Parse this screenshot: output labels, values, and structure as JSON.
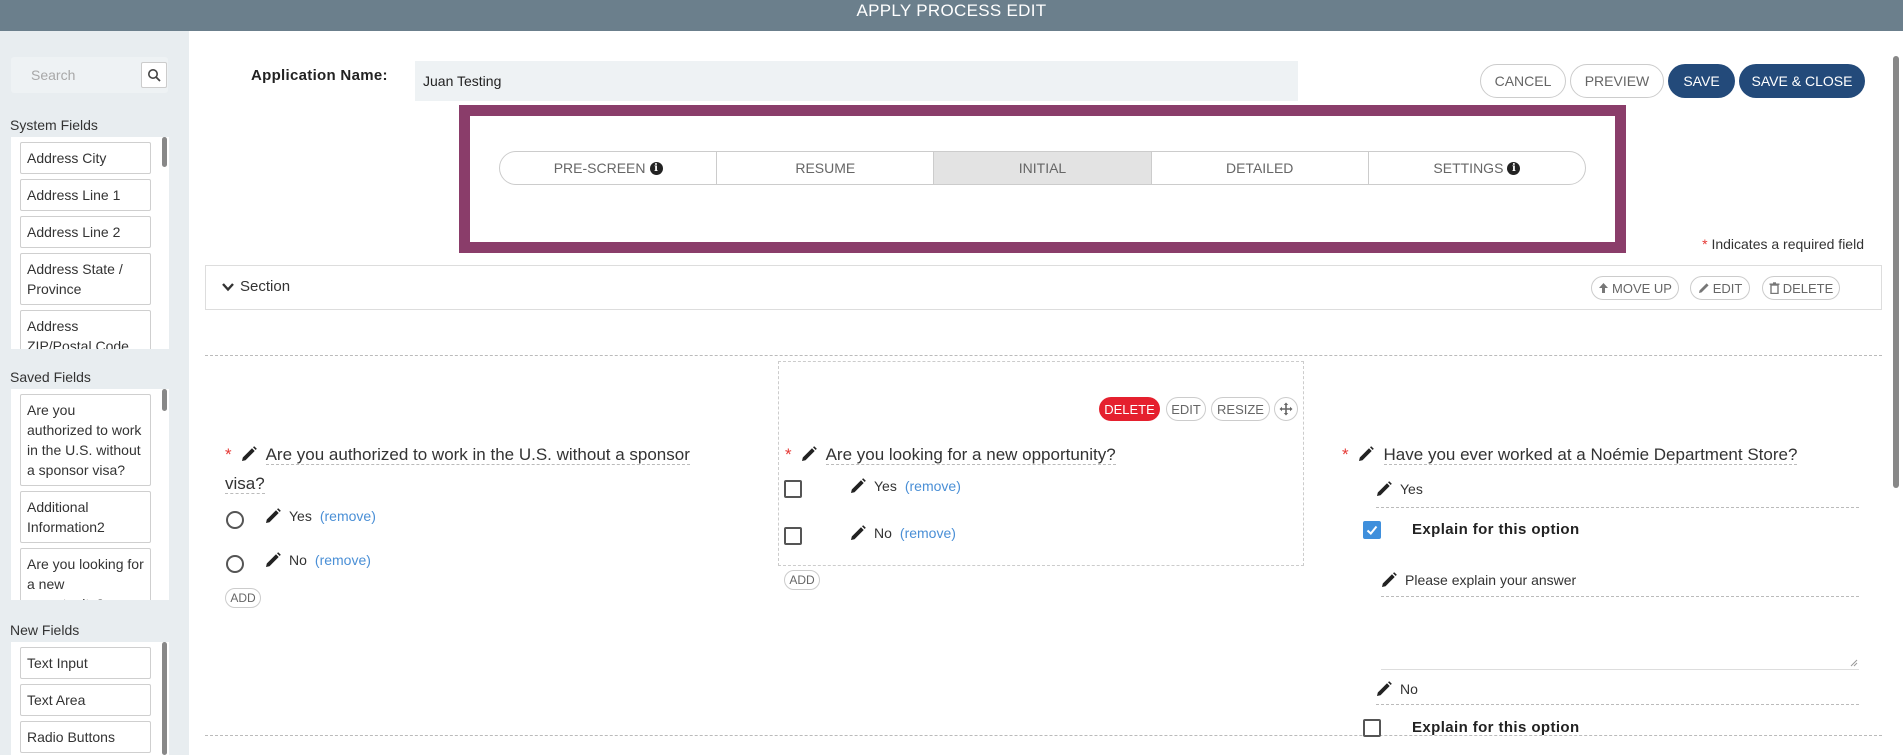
{
  "header": {
    "title": "APPLY PROCESS EDIT"
  },
  "sidebar": {
    "search_placeholder": "Search",
    "system_fields": {
      "heading": "System Fields",
      "items": [
        "Address City",
        "Address Line 1",
        "Address Line 2",
        "Address State / Province",
        "Address ZIP/Postal Code"
      ]
    },
    "saved_fields": {
      "heading": "Saved Fields",
      "items": [
        "Are you authorized to work in the U.S. without a sponsor visa?",
        "Additional Information2",
        "Are you looking for a new opportunity?"
      ]
    },
    "new_fields": {
      "heading": "New Fields",
      "items": [
        "Text Input",
        "Text Area",
        "Radio Buttons"
      ]
    }
  },
  "form": {
    "app_name_label": "Application Name:",
    "app_name_value": "Juan Testing",
    "buttons": {
      "cancel": "CANCEL",
      "preview": "PREVIEW",
      "save": "SAVE",
      "save_close": "SAVE & CLOSE"
    },
    "tabs": [
      {
        "label": "PRE-SCREEN",
        "info": true
      },
      {
        "label": "RESUME",
        "info": false
      },
      {
        "label": "INITIAL",
        "info": false,
        "active": true
      },
      {
        "label": "DETAILED",
        "info": false
      },
      {
        "label": "SETTINGS",
        "info": true
      }
    ],
    "required_note": "Indicates a required field",
    "required_star": "*"
  },
  "section": {
    "label": "Section",
    "move_up": "MOVE UP",
    "edit": "EDIT",
    "delete": "DELETE"
  },
  "field_toolbar": {
    "delete": "DELETE",
    "edit": "EDIT",
    "resize": "RESIZE"
  },
  "questions": {
    "q1": {
      "title_line1": "Are you authorized to work in the U.S. without a sponsor",
      "title_line2": "visa?",
      "options": [
        "Yes",
        "No"
      ],
      "remove": "(remove)",
      "add": "ADD"
    },
    "q2": {
      "title": "Are you looking for a new opportunity?",
      "options": [
        "Yes",
        "No"
      ],
      "remove": "(remove)",
      "add": "ADD"
    },
    "q3": {
      "title": "Have you ever worked at a Noémie Department Store?",
      "option_yes": "Yes",
      "option_no": "No",
      "explain": "Explain for this option",
      "explain_placeholder": "Please explain your answer",
      "yes_explain_checked": true,
      "no_explain_checked": false
    }
  },
  "colors": {
    "topbar": "#6b7f8c",
    "primary": "#234a7a",
    "highlight": "#8a3d6a",
    "danger": "#e5202e",
    "link": "#4a8fd6"
  }
}
